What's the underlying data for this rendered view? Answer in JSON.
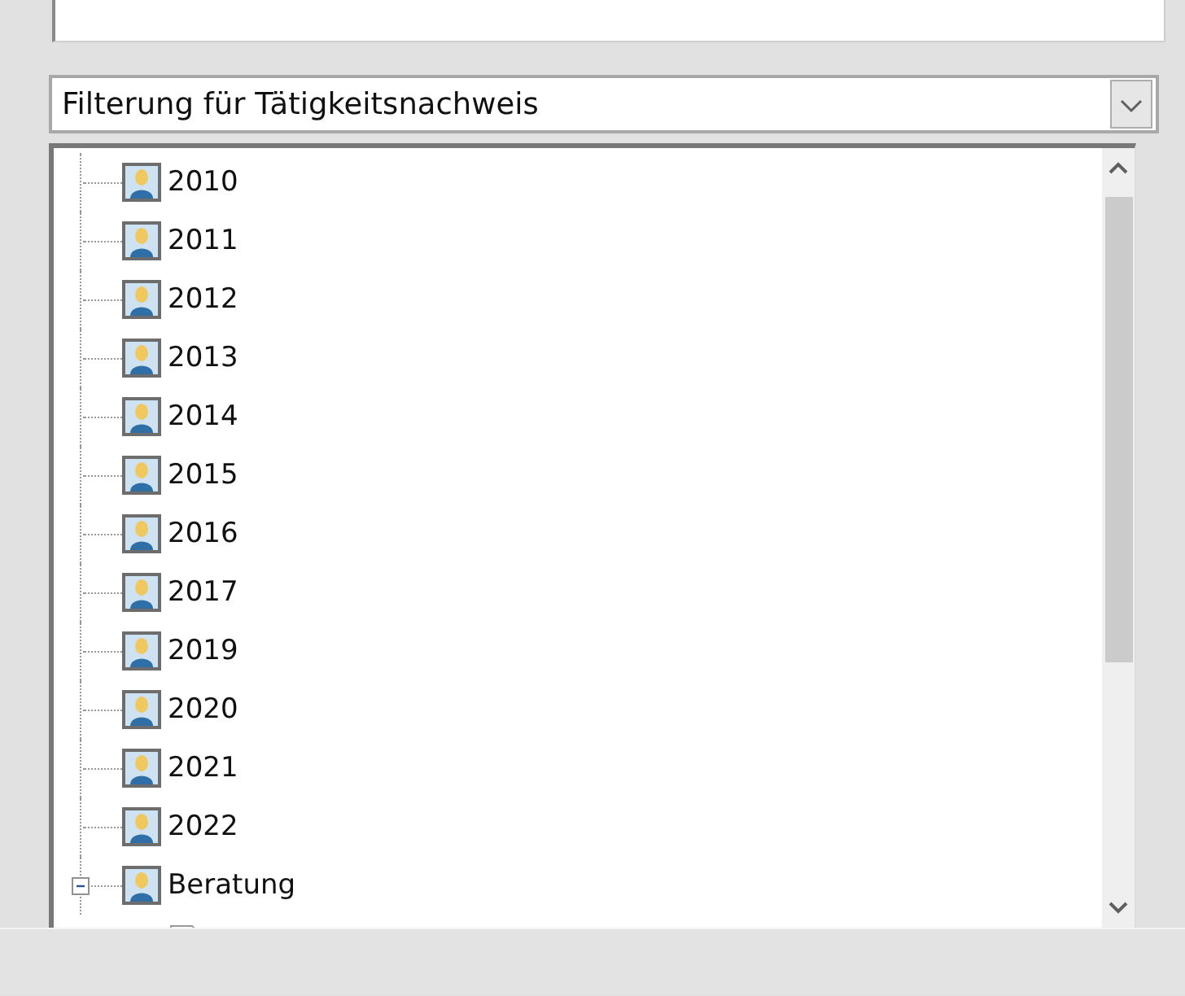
{
  "filter_dropdown": {
    "value": "Filterung für Tätigkeitsnachweis"
  },
  "tree": {
    "items": [
      {
        "label": "2010"
      },
      {
        "label": "2011"
      },
      {
        "label": "2012"
      },
      {
        "label": "2013"
      },
      {
        "label": "2014"
      },
      {
        "label": "2015"
      },
      {
        "label": "2016"
      },
      {
        "label": "2017"
      },
      {
        "label": "2019"
      },
      {
        "label": "2020"
      },
      {
        "label": "2021"
      },
      {
        "label": "2022"
      },
      {
        "label": "Beratung",
        "expanded": true
      }
    ]
  }
}
